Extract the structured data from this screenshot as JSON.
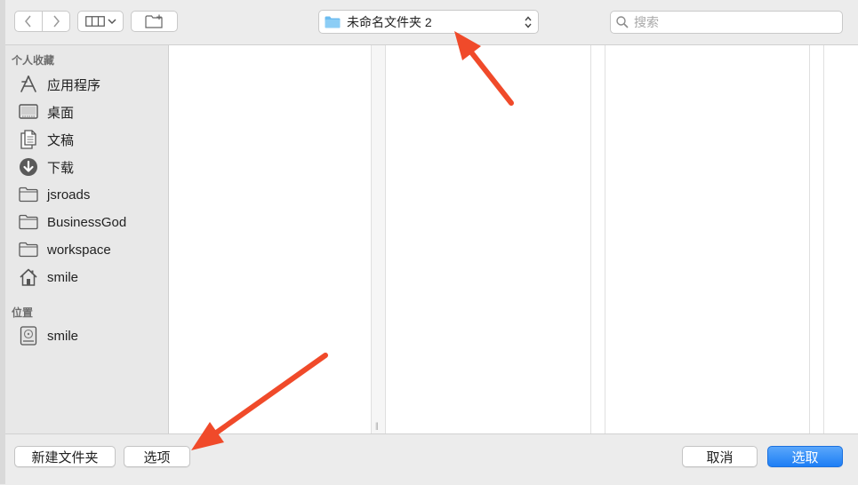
{
  "toolbar": {
    "path_label": "未命名文件夹 2",
    "search_placeholder": "搜索"
  },
  "sidebar": {
    "favorites_header": "个人收藏",
    "favorites": [
      {
        "label": "应用程序",
        "icon": "applications-icon"
      },
      {
        "label": "桌面",
        "icon": "desktop-icon"
      },
      {
        "label": "文稿",
        "icon": "documents-icon"
      },
      {
        "label": "下载",
        "icon": "downloads-icon"
      },
      {
        "label": "jsroads",
        "icon": "folder-icon"
      },
      {
        "label": "BusinessGod",
        "icon": "folder-icon"
      },
      {
        "label": "workspace",
        "icon": "folder-icon"
      },
      {
        "label": "smile",
        "icon": "home-icon"
      }
    ],
    "locations_header": "位置",
    "locations": [
      {
        "label": "smile",
        "icon": "disk-icon"
      }
    ]
  },
  "bottombar": {
    "new_folder_label": "新建文件夹",
    "options_label": "选项",
    "cancel_label": "取消",
    "choose_label": "选取"
  },
  "colors": {
    "accent": "#1d7ef5",
    "annotation_arrow": "#f04a2a",
    "folder_blue": "#6cbcf0"
  }
}
